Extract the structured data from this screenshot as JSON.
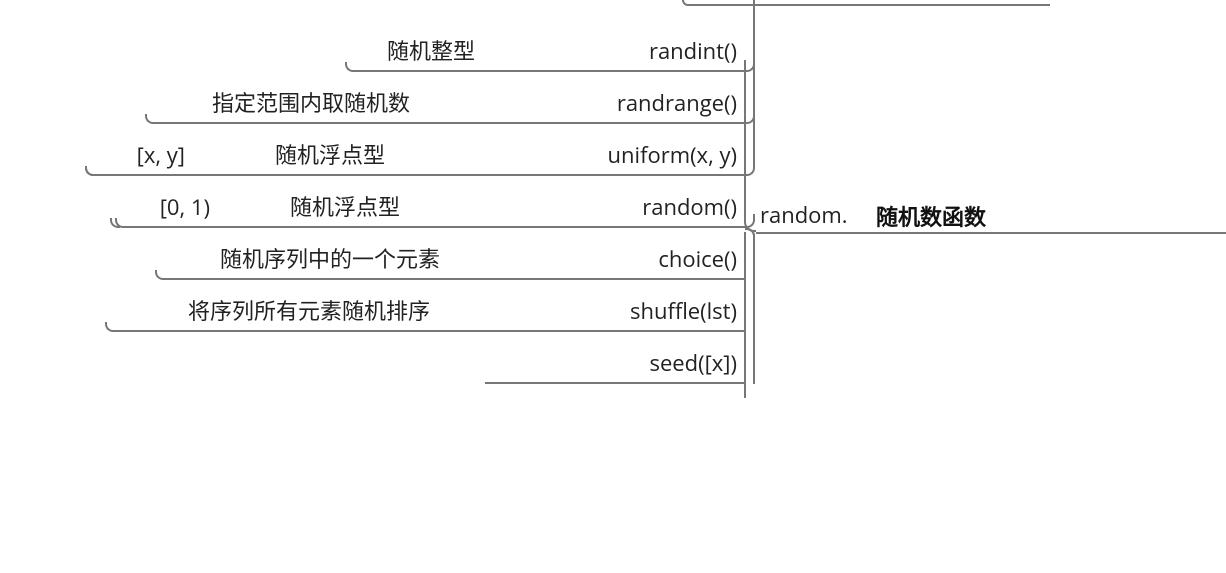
{
  "root": {
    "title": "随机数函数",
    "prefix": "random."
  },
  "functions": [
    {
      "name": "randint()",
      "desc": "随机整型",
      "range": ""
    },
    {
      "name": "randrange()",
      "desc": "指定范围内取随机数",
      "range": ""
    },
    {
      "name": "uniform(x, y)",
      "desc": "随机浮点型",
      "range": "[x, y]"
    },
    {
      "name": "random()",
      "desc": "随机浮点型",
      "range": "[0, 1)"
    },
    {
      "name": "choice()",
      "desc": "随机序列中的一个元素",
      "range": ""
    },
    {
      "name": "shuffle(lst)",
      "desc": "将序列所有元素随机排序",
      "range": ""
    },
    {
      "name": "seed([x])",
      "desc": "",
      "range": ""
    }
  ]
}
